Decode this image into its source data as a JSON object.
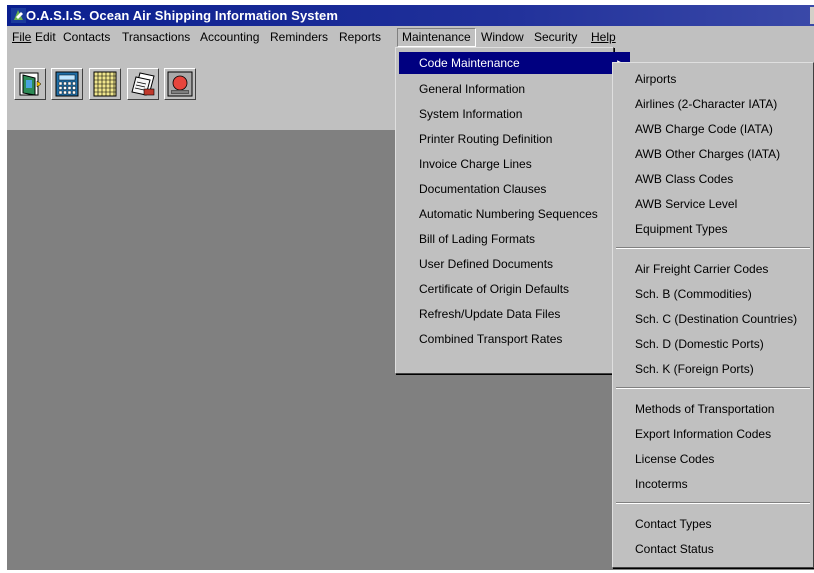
{
  "window": {
    "title": "O.A.S.I.S.  Ocean Air Shipping Information System"
  },
  "menubar": {
    "items": [
      {
        "id": "file",
        "label": "File"
      },
      {
        "id": "edit",
        "label": "Edit"
      },
      {
        "id": "contacts",
        "label": "Contacts"
      },
      {
        "id": "transactions",
        "label": "Transactions"
      },
      {
        "id": "accounting",
        "label": "Accounting"
      },
      {
        "id": "reminders",
        "label": "Reminders"
      },
      {
        "id": "reports",
        "label": "Reports"
      },
      {
        "id": "maintenance",
        "label": "Maintenance"
      },
      {
        "id": "window",
        "label": "Window"
      },
      {
        "id": "security",
        "label": "Security"
      },
      {
        "id": "help",
        "label": "Help"
      }
    ]
  },
  "toolbar": {
    "buttons": [
      {
        "icon": "exit-door-icon"
      },
      {
        "icon": "calculator-icon"
      },
      {
        "icon": "calendar-grid-icon"
      },
      {
        "icon": "documents-stack-icon"
      },
      {
        "icon": "alarm-reminder-icon"
      }
    ]
  },
  "maintenance_menu": {
    "items": [
      {
        "label": "Code Maintenance",
        "submenu": true,
        "highlighted": true
      },
      {
        "label": "General Information"
      },
      {
        "label": "System Information"
      },
      {
        "label": "Printer Routing Definition"
      },
      {
        "label": "Invoice Charge Lines"
      },
      {
        "label": "Documentation Clauses"
      },
      {
        "label": "Automatic Numbering Sequences"
      },
      {
        "label": "Bill of Lading Formats"
      },
      {
        "label": "User Defined Documents"
      },
      {
        "label": "Certificate of Origin Defaults"
      },
      {
        "label": "Refresh/Update Data Files"
      },
      {
        "label": "Combined Transport Rates"
      }
    ]
  },
  "code_maintenance_submenu": {
    "groups": [
      [
        "Airports",
        "Airlines (2-Character IATA)",
        "AWB Charge Code (IATA)",
        "AWB Other Charges (IATA)",
        "AWB Class Codes",
        "AWB Service Level",
        "Equipment Types"
      ],
      [
        "Air Freight Carrier Codes",
        "Sch. B (Commodities)",
        "Sch. C (Destination Countries)",
        "Sch. D (Domestic Ports)",
        "Sch. K (Foreign Ports)"
      ],
      [
        "Methods of Transportation",
        "Export Information Codes",
        "License Codes",
        "Incoterms"
      ],
      [
        "Contact Types",
        "Contact Status"
      ]
    ]
  }
}
